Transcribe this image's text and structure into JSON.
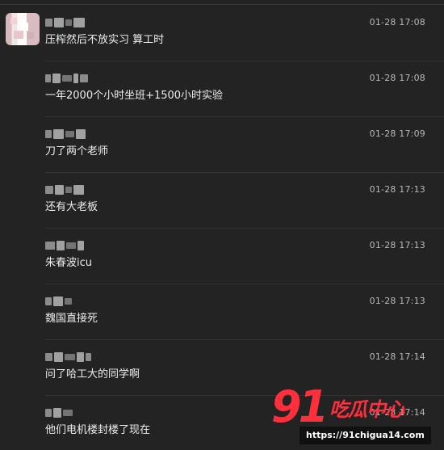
{
  "comments": [
    {
      "time": "01-28 17:08",
      "text": "压榨然后不放实习 算工时"
    },
    {
      "time": "01-28 17:08",
      "text": "一年2000个小时坐班+1500小时实验"
    },
    {
      "time": "01-28 17:09",
      "text": "刀了两个老师"
    },
    {
      "time": "01-28 17:13",
      "text": "还有大老板"
    },
    {
      "time": "01-28 17:13",
      "text": "朱春波icu"
    },
    {
      "time": "01-28 17:13",
      "text": "魏国直接死"
    },
    {
      "time": "01-28 17:14",
      "text": "问了哈工大的同学啊"
    },
    {
      "time": "01-28 17:14",
      "text": "他们电机楼封楼了现在"
    }
  ],
  "watermark": {
    "logo_number": "91",
    "logo_text": "吃瓜中心",
    "url": "https://91chigua14.com"
  },
  "icons": {
    "avatar": "pixelated-user-avatar-icon"
  },
  "colors": {
    "background": "#232323",
    "text": "#ededed",
    "timestamp": "#b8b8b8",
    "divider": "#323232",
    "watermark_red": "#ff2f3c"
  }
}
